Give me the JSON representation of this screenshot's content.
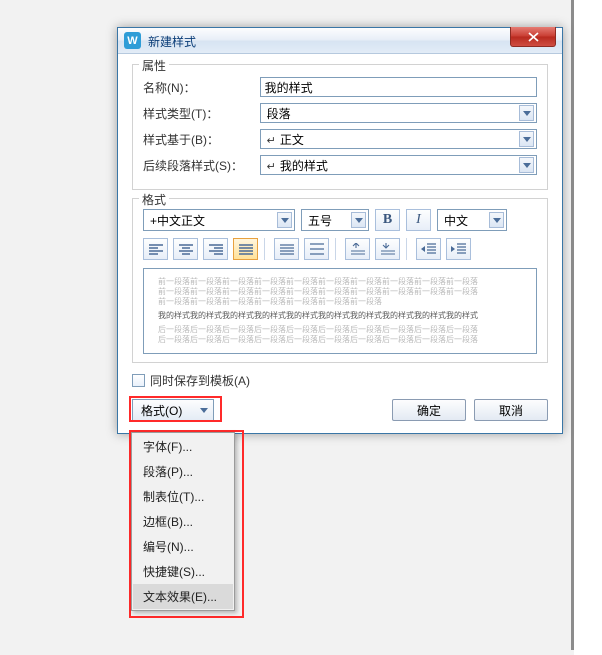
{
  "dialog": {
    "title": "新建样式",
    "app_icon_letter": "W",
    "close_label": "X"
  },
  "props": {
    "legend": "属性",
    "name_label": "名称(N)：",
    "name_value": "我的样式",
    "type_label": "样式类型(T)：",
    "type_value": "段落",
    "basedon_label": "样式基于(B)：",
    "basedon_value": "正文",
    "follow_label": "后续段落样式(S)：",
    "follow_value": "我的样式"
  },
  "format": {
    "legend": "格式",
    "font_value": "+中文正文",
    "size_value": "五号",
    "bold_label": "B",
    "italic_label": "I",
    "lang_value": "中文"
  },
  "preview": {
    "faint1": "前一段落前一段落前一段落前一段落前一段落前一段落前一段落前一段落前一段落前一段落",
    "faint2": "前一段落前一段落前一段落前一段落前一段落前一段落前一段落前一段落前一段落前一段落",
    "faint3": "前一段落前一段落前一段落前一段落前一段落前一段落前一段落",
    "strong": "我的样式我的样式我的样式我的样式我的样式我的样式我的样式我的样式我的样式我的样式",
    "faint4": "后一段落后一段落后一段落后一段落后一段落后一段落后一段落后一段落后一段落后一段落",
    "faint5": "后一段落后一段落后一段落后一段落后一段落后一段落后一段落后一段落后一段落后一段落"
  },
  "save_tpl_label": "同时保存到模板(A)",
  "format_menu_btn": "格式(O)",
  "ok_label": "确定",
  "cancel_label": "取消",
  "menu": {
    "items": [
      "字体(F)...",
      "段落(P)...",
      "制表位(T)...",
      "边框(B)...",
      "编号(N)...",
      "快捷键(S)...",
      "文本效果(E)..."
    ]
  }
}
